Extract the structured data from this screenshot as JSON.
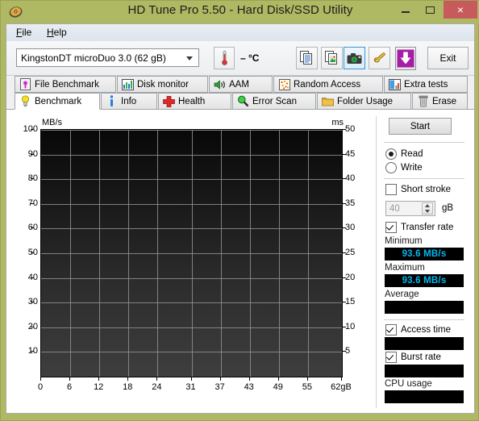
{
  "window": {
    "title": "HD Tune Pro 5.50 - Hard Disk/SSD Utility",
    "app_icon": "hard-disk-icon",
    "minimize": "–",
    "maximize": "□",
    "close": "×",
    "titlebar_color": "#afb862",
    "close_color": "#c75b5b"
  },
  "menu": {
    "items": [
      {
        "label": "File",
        "mnemonic": "F"
      },
      {
        "label": "Help",
        "mnemonic": "H"
      }
    ]
  },
  "toolbar": {
    "drive": {
      "selected": "KingstonDT microDuo 3.0 (62 gB)",
      "caret": "chevron-down-icon"
    },
    "temperature": {
      "icon": "thermometer-icon",
      "value": "– °C"
    },
    "buttons": [
      {
        "name": "copy-icon",
        "label": ""
      },
      {
        "name": "copy-image-icon",
        "label": ""
      },
      {
        "name": "screenshot-camera-icon",
        "label": "",
        "selected": true
      },
      {
        "name": "benchmark-compare-icon",
        "label": ""
      },
      {
        "name": "save-download-icon",
        "label": ""
      }
    ],
    "exit_label": "Exit"
  },
  "tabs": {
    "row1": [
      {
        "label": "File Benchmark",
        "icon": "file-benchmark-icon",
        "active": false
      },
      {
        "label": "Disk monitor",
        "icon": "disk-monitor-icon",
        "active": false
      },
      {
        "label": "AAM",
        "icon": "speaker-icon",
        "active": false
      },
      {
        "label": "Random Access",
        "icon": "random-access-icon",
        "active": false
      },
      {
        "label": "Extra tests",
        "icon": "extra-tests-icon",
        "active": false
      }
    ],
    "row2": [
      {
        "label": "Benchmark",
        "icon": "benchmark-bulb-icon",
        "active": true
      },
      {
        "label": "Info",
        "icon": "info-icon",
        "active": false
      },
      {
        "label": "Health",
        "icon": "health-cross-icon",
        "active": false
      },
      {
        "label": "Error Scan",
        "icon": "magnifier-icon",
        "active": false
      },
      {
        "label": "Folder Usage",
        "icon": "folder-icon",
        "active": false
      },
      {
        "label": "Erase",
        "icon": "trash-icon",
        "active": false
      }
    ]
  },
  "chart_data": {
    "type": "line",
    "title": "",
    "ylabel": "MB/s",
    "ylabel_right": "ms",
    "xlabel": "gB",
    "y_ticks_left": [
      100,
      90,
      80,
      70,
      60,
      50,
      40,
      30,
      20,
      10
    ],
    "y_ticks_right": [
      50,
      45,
      40,
      35,
      30,
      25,
      20,
      15,
      10,
      5
    ],
    "ylim": [
      0,
      100
    ],
    "ylim_right": [
      0,
      50
    ],
    "x_ticks": [
      "0",
      "6",
      "12",
      "18",
      "24",
      "31",
      "37",
      "43",
      "49",
      "55",
      "62gB"
    ],
    "x_tick_values": [
      0,
      6,
      12,
      18,
      24,
      31,
      37,
      43,
      49,
      55,
      62
    ],
    "xlim": [
      0,
      62
    ],
    "grid": true,
    "background": "#1f1f1f",
    "series": [
      {
        "name": "Transfer rate",
        "color": "#ffff00",
        "values": []
      },
      {
        "name": "Access time",
        "color": "#ff0000",
        "values": []
      }
    ],
    "note": "Plot area is empty - benchmark not yet run"
  },
  "side_panel": {
    "start_label": "Start",
    "mode": {
      "read": {
        "label": "Read",
        "selected": true
      },
      "write": {
        "label": "Write",
        "selected": false
      }
    },
    "short_stroke": {
      "label": "Short stroke",
      "checked": false
    },
    "short_stroke_value": "40",
    "short_stroke_unit": "gB",
    "transfer_rate": {
      "label": "Transfer rate",
      "checked": true
    },
    "minimum": {
      "label": "Minimum",
      "value": "93.6 MB/s"
    },
    "maximum": {
      "label": "Maximum",
      "value": "93.6 MB/s"
    },
    "average": {
      "label": "Average",
      "value": ""
    },
    "access_time": {
      "label": "Access time",
      "checked": true,
      "value": ""
    },
    "burst_rate": {
      "label": "Burst rate",
      "checked": true,
      "value": ""
    },
    "cpu_usage": {
      "label": "CPU usage",
      "value": ""
    },
    "value_color": "#00b8f0"
  }
}
